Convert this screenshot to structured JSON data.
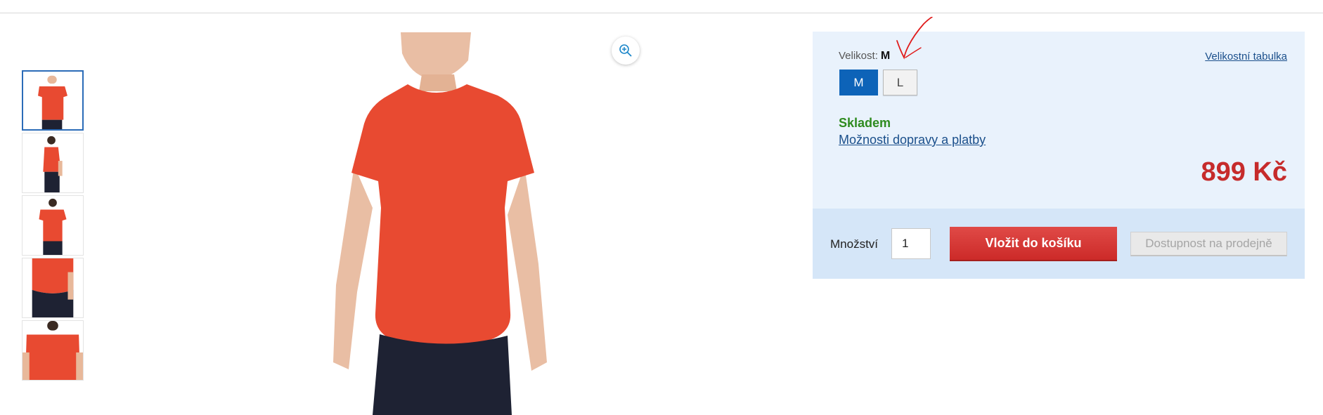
{
  "gallery": {
    "thumbnails": [
      {
        "view": "front",
        "active": true
      },
      {
        "view": "side",
        "active": false
      },
      {
        "view": "back",
        "active": false
      },
      {
        "view": "back-hem-detail",
        "active": false
      },
      {
        "view": "back-upper-detail",
        "active": false
      }
    ],
    "zoom_icon": "zoom-in-icon"
  },
  "product": {
    "size_label": "Velikost:",
    "selected_size": "M",
    "size_chart_link": "Velikostní tabulka",
    "sizes": [
      {
        "label": "M",
        "selected": true
      },
      {
        "label": "L",
        "selected": false
      }
    ],
    "stock_status": "Skladem",
    "shipping_link": "Možnosti dopravy a platby",
    "price": "899 Kč"
  },
  "purchase": {
    "quantity_label": "Množství",
    "quantity_value": "1",
    "add_to_cart": "Vložit do košíku",
    "store_availability": "Dostupnost na prodejně"
  },
  "colors": {
    "accent_blue": "#0d63b8",
    "price_red": "#c62b2b",
    "stock_green": "#2e8b1f",
    "shirt": "#e84a31",
    "panel_bg": "#e9f2fc",
    "panel_bottom_bg": "#d5e6f8",
    "annotation": "#e01b1b"
  }
}
